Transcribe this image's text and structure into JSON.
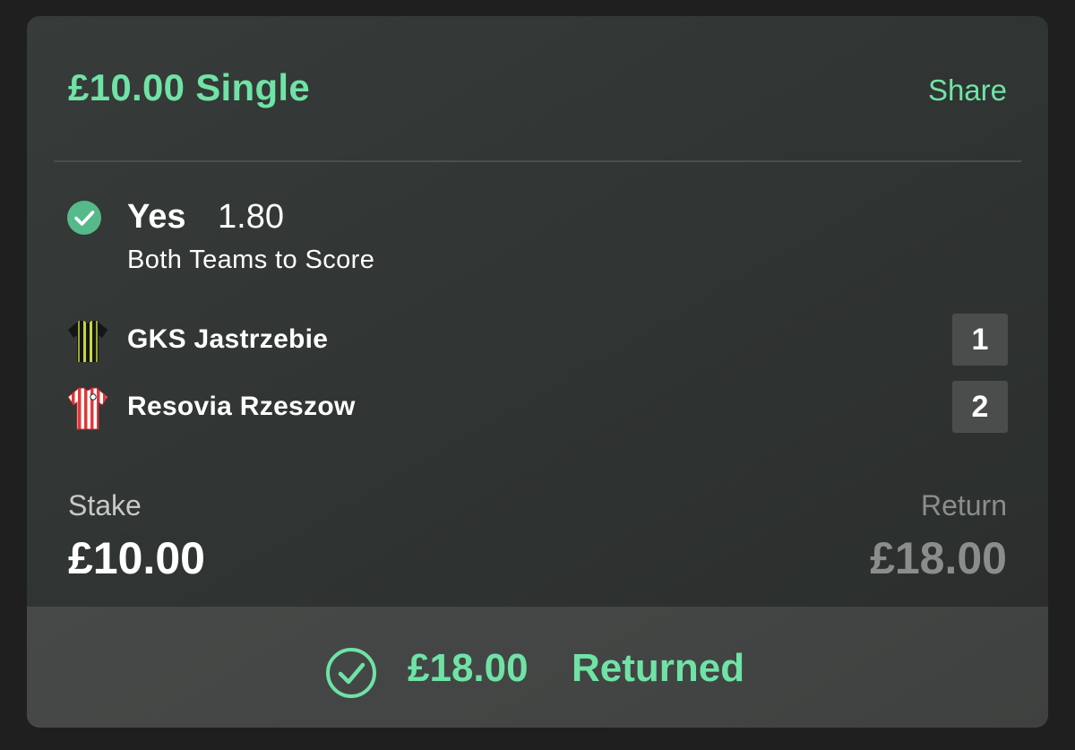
{
  "bet": {
    "title": "£10.00 Single",
    "share_label": "Share"
  },
  "selection": {
    "name": "Yes",
    "odds": "1.80",
    "market": "Both Teams to Score",
    "status_icon": "check-circle-icon"
  },
  "teams": [
    {
      "name": "GKS Jastrzebie",
      "score": "1",
      "kit_icon": "black-yellow-striped-shirt-icon"
    },
    {
      "name": "Resovia Rzeszow",
      "score": "2",
      "kit_icon": "red-white-striped-shirt-icon"
    }
  ],
  "stake": {
    "label": "Stake",
    "value": "£10.00"
  },
  "return": {
    "label": "Return",
    "value": "£18.00"
  },
  "footer": {
    "amount": "£18.00",
    "status": "Returned",
    "icon": "check-circle-outline-icon"
  },
  "colors": {
    "accent": "#6fe3a6",
    "card_bg": "#333735",
    "footer_bg": "#454746",
    "muted_text": "#8a8d8b"
  }
}
